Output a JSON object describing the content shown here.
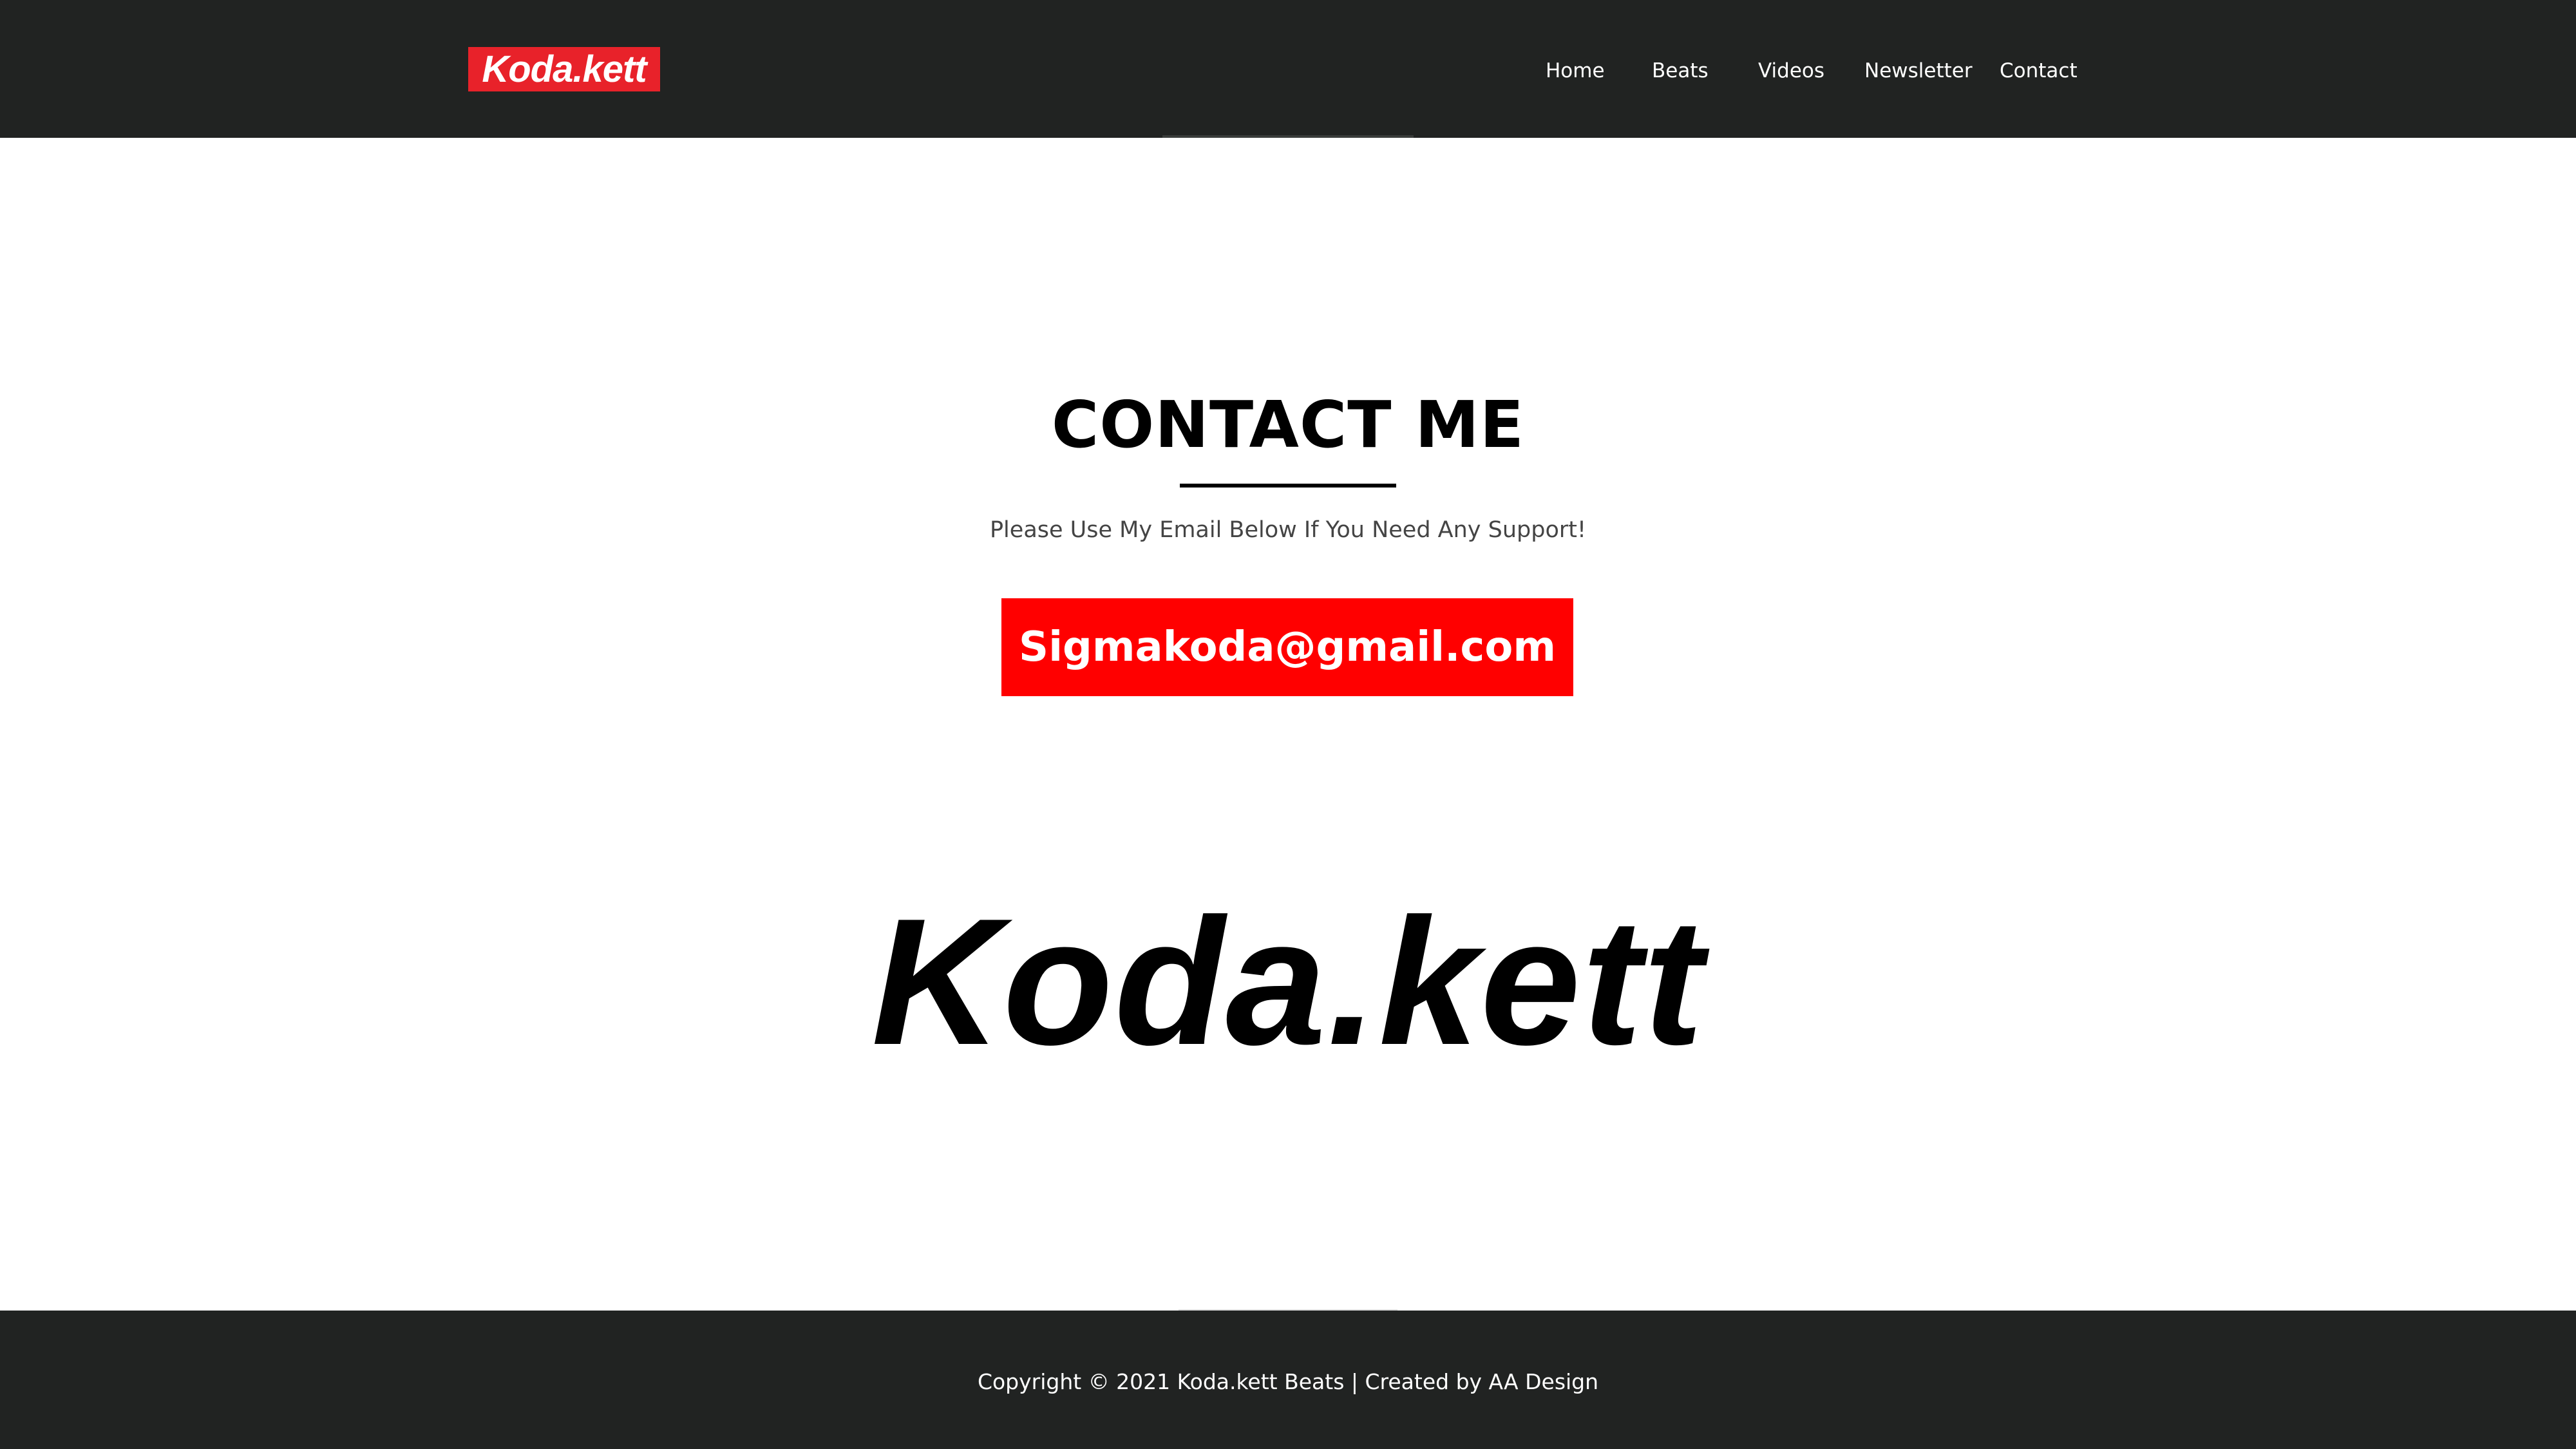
{
  "header": {
    "logo_text": "Koda.kett",
    "nav": {
      "home": "Home",
      "beats": "Beats",
      "videos": "Videos",
      "newsletter": "Newsletter",
      "contact": "Contact"
    }
  },
  "main": {
    "title": "CONTACT ME",
    "subtitle": "Please Use My Email Below If You Need Any Support!",
    "email_button": "Sigmakoda@gmail.com",
    "brand_logo": "Koda.kett"
  },
  "footer": {
    "copyright": "Copyright © 2021 Koda.kett Beats | Created by AA Design"
  },
  "colors": {
    "header_bg": "#212322",
    "logo_badge": "#e8222a",
    "button_red": "#ff0000",
    "text_dark": "#000000",
    "footer_bg": "#212322"
  }
}
